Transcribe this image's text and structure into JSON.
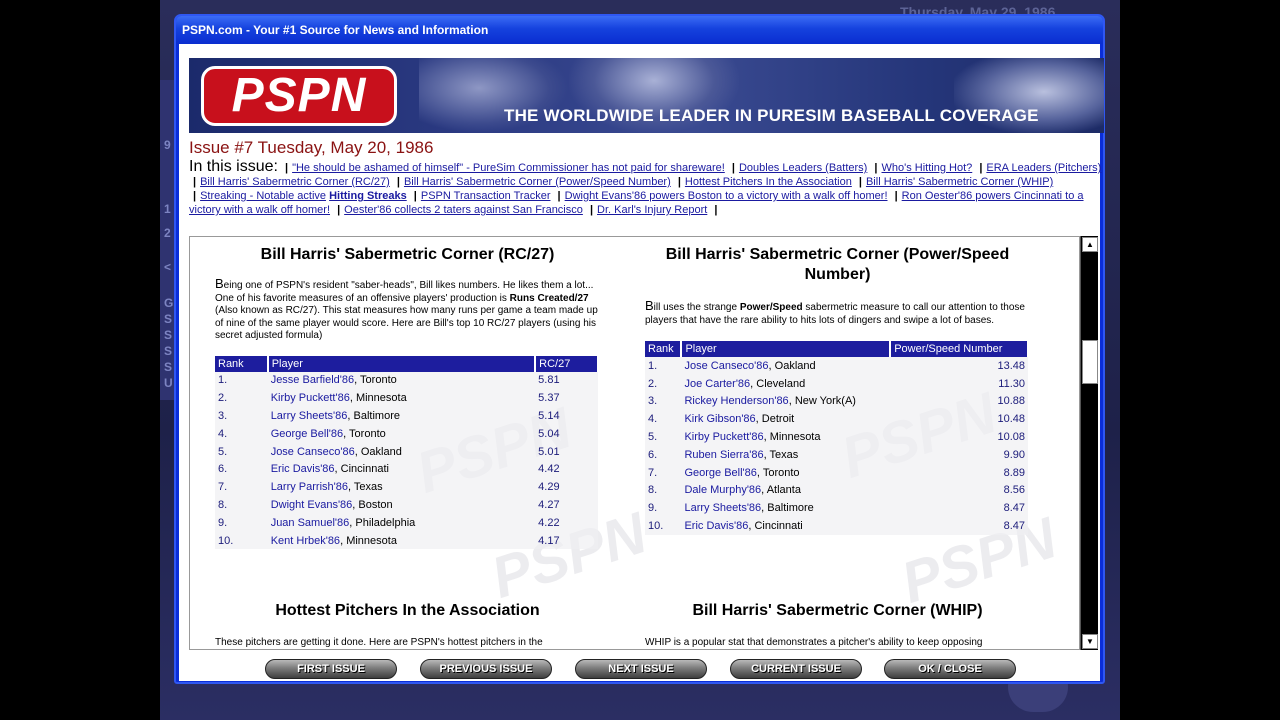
{
  "background": {
    "date": "Thursday, May 29, 1986",
    "side_letters": [
      "9",
      "1",
      "2",
      "<",
      "G",
      "S",
      "S",
      "S",
      "S",
      "U"
    ]
  },
  "window": {
    "title": "PSPN.com - Your #1 Source for News and Information"
  },
  "banner": {
    "logo": "PSPN",
    "tagline": "THE WORLDWIDE LEADER IN PURESIM BASEBALL COVERAGE"
  },
  "issue": {
    "header": "Issue #7 Tuesday, May 20, 1986"
  },
  "toc": {
    "label": "In this issue:",
    "items": [
      "\"He should be ashamed of himself\" - PureSim Commissioner has not paid for shareware!",
      "Doubles Leaders (Batters)",
      "Who's Hitting Hot?",
      "ERA Leaders (Pitchers)",
      "Bill Harris' Sabermetric Corner (RC/27)",
      "Bill Harris' Sabermetric Corner (Power/Speed Number)",
      "Hottest Pitchers In the Association",
      "Bill Harris' Sabermetric Corner (WHIP)",
      "Streaking - Notable active",
      "Hitting Streaks",
      "PSPN Transaction Tracker",
      "Dwight Evans'86 powers Boston to a victory with a walk off homer!",
      "Ron Oester'86 powers Cincinnati to a victory with a walk off homer!",
      "Oester'86 collects 2 taters against San Francisco",
      "Dr. Karl's Injury Report"
    ]
  },
  "rc27": {
    "title": "Bill Harris' Sabermetric Corner (RC/27)",
    "intro_cap": "B",
    "intro_1": "eing one of PSPN's resident \"saber-heads\", Bill likes numbers. He likes them a lot... One of his favorite measures of an offensive players' production is ",
    "intro_bold": "Runs Created/27",
    "intro_2": " (Also known as RC/27). This stat measures how many runs per game a team made up of nine of the same player would score. Here are Bill's top 10 RC/27 players (using his secret adjusted formula)",
    "columns": [
      "Rank",
      "Player",
      "RC/27"
    ],
    "rows": [
      [
        "1.",
        "Jesse Barfield'86",
        "Toronto",
        "5.81"
      ],
      [
        "2.",
        "Kirby Puckett'86",
        "Minnesota",
        "5.37"
      ],
      [
        "3.",
        "Larry Sheets'86",
        "Baltimore",
        "5.14"
      ],
      [
        "4.",
        "George Bell'86",
        "Toronto",
        "5.04"
      ],
      [
        "5.",
        "Jose Canseco'86",
        "Oakland",
        "5.01"
      ],
      [
        "6.",
        "Eric Davis'86",
        "Cincinnati",
        "4.42"
      ],
      [
        "7.",
        "Larry Parrish'86",
        "Texas",
        "4.29"
      ],
      [
        "8.",
        "Dwight Evans'86",
        "Boston",
        "4.27"
      ],
      [
        "9.",
        "Juan Samuel'86",
        "Philadelphia",
        "4.22"
      ],
      [
        "10.",
        "Kent Hrbek'86",
        "Minnesota",
        "4.17"
      ]
    ]
  },
  "psn": {
    "title": "Bill Harris' Sabermetric Corner (Power/Speed Number)",
    "intro_cap": "B",
    "intro_1": "ill uses the strange ",
    "intro_bold": "Power/Speed",
    "intro_2": " sabermetric measure to call our attention to those players that have the rare ability to hits lots of dingers and swipe a lot of bases.",
    "columns": [
      "Rank",
      "Player",
      "Power/Speed Number"
    ],
    "rows": [
      [
        "1.",
        "Jose Canseco'86",
        "Oakland",
        "13.48"
      ],
      [
        "2.",
        "Joe Carter'86",
        "Cleveland",
        "11.30"
      ],
      [
        "3.",
        "Rickey Henderson'86",
        "New York(A)",
        "10.88"
      ],
      [
        "4.",
        "Kirk Gibson'86",
        "Detroit",
        "10.48"
      ],
      [
        "5.",
        "Kirby Puckett'86",
        "Minnesota",
        "10.08"
      ],
      [
        "6.",
        "Ruben Sierra'86",
        "Texas",
        "9.90"
      ],
      [
        "7.",
        "George Bell'86",
        "Toronto",
        "8.89"
      ],
      [
        "8.",
        "Dale Murphy'86",
        "Atlanta",
        "8.56"
      ],
      [
        "9.",
        "Larry Sheets'86",
        "Baltimore",
        "8.47"
      ],
      [
        "10.",
        "Eric Davis'86",
        "Cincinnati",
        "8.47"
      ]
    ]
  },
  "hottest": {
    "title": "Hottest Pitchers In the Association",
    "intro": "These pitchers are getting it done. Here are PSPN's hottest pitchers in the"
  },
  "whip": {
    "title": "Bill Harris' Sabermetric Corner (WHIP)",
    "intro": "WHIP is a popular stat that demonstrates a pitcher's ability to keep opposing"
  },
  "buttons": {
    "first": "FIRST ISSUE",
    "previous": "PREVIOUS ISSUE",
    "next": "NEXT ISSUE",
    "current": "CURRENT ISSUE",
    "close": "OK / CLOSE"
  }
}
